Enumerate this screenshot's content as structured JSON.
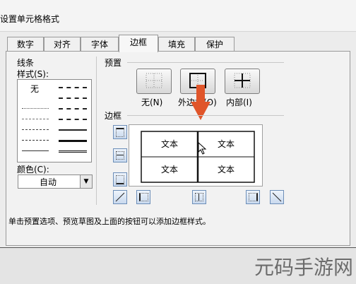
{
  "window": {
    "title": "设置单元格格式"
  },
  "tabs": [
    {
      "label": "数字"
    },
    {
      "label": "对齐"
    },
    {
      "label": "字体"
    },
    {
      "label": "边框"
    },
    {
      "label": "填充"
    },
    {
      "label": "保护"
    }
  ],
  "line_section": {
    "group_label": "线条",
    "style_label": "样式(S):",
    "none_label": "无",
    "color_label": "颜色(C):",
    "color_value": "自动"
  },
  "presets": {
    "group_label": "预置",
    "items": [
      {
        "label": "无(N)"
      },
      {
        "label": "外边框(O)"
      },
      {
        "label": "内部(I)"
      }
    ]
  },
  "border": {
    "group_label": "边框",
    "preview_cells": [
      "文本",
      "文本",
      "文本",
      "文本"
    ]
  },
  "status_text": "单击预置选项、预览草图及上面的按钮可以添加边框样式。",
  "watermark": "元码手游网",
  "colors": {
    "arrow": "#e0552a",
    "button_border": "#6c8eb8"
  }
}
